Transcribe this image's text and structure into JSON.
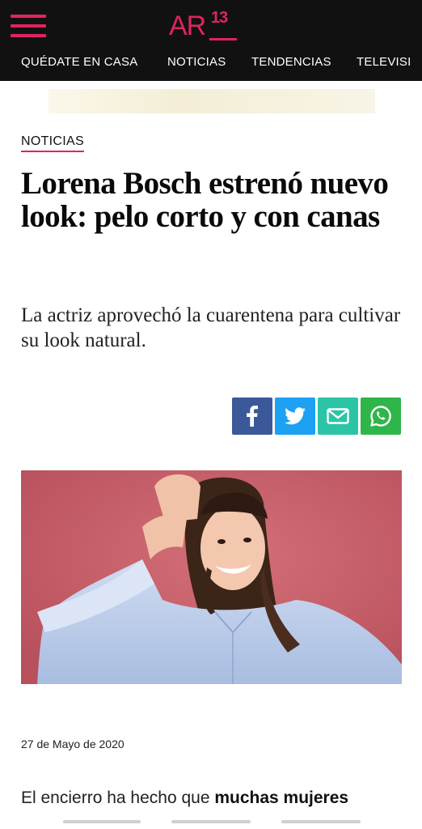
{
  "header": {
    "logo_main": "AR",
    "logo_num": "13",
    "menu_icon": "hamburger-menu-icon",
    "accent_color": "#e0245e"
  },
  "nav": {
    "items": [
      "QUÉDATE EN CASA",
      "NOTICIAS",
      "TENDENCIAS",
      "TELEVISI"
    ]
  },
  "article": {
    "section": "NOTICIAS",
    "headline": "Lorena Bosch estrenó nuevo look: pelo corto y con canas",
    "subtitle": "La actriz aprovechó la cuarentena para cultivar su look natural.",
    "date": "27 de Mayo de 2020",
    "body_start": "El encierro ha hecho que ",
    "body_bold": "muchas mujeres"
  },
  "share": [
    {
      "icon": "facebook-icon",
      "color": "#3b5998"
    },
    {
      "icon": "twitter-icon",
      "color": "#1da1f2"
    },
    {
      "icon": "email-icon",
      "color": "#2cc4a7"
    },
    {
      "icon": "whatsapp-icon",
      "color": "#2fb64a"
    }
  ]
}
